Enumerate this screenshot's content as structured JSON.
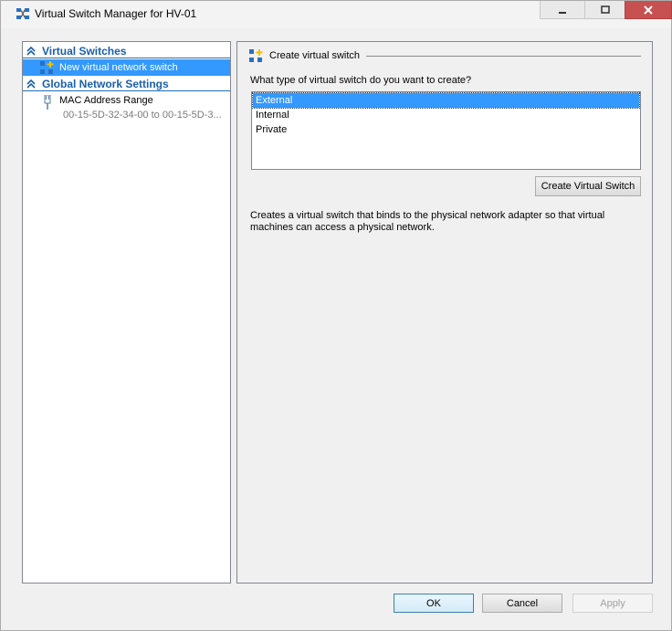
{
  "window": {
    "title": "Virtual Switch Manager for HV-01"
  },
  "titlebar_controls": {
    "minimize_icon": "minimize-icon",
    "maximize_icon": "maximize-icon",
    "close_icon": "close-icon"
  },
  "sidebar": {
    "sections": [
      {
        "label": "Virtual Switches",
        "items": [
          {
            "label": "New virtual network switch",
            "icon": "add-switch-icon",
            "selected": true
          }
        ]
      },
      {
        "label": "Global Network Settings",
        "items": [
          {
            "label": "MAC Address Range",
            "sublabel": "00-15-5D-32-34-00 to 00-15-5D-3...",
            "icon": "network-adapter-icon"
          }
        ]
      }
    ]
  },
  "main": {
    "group_title": "Create virtual switch",
    "question": "What type of virtual switch do you want to create?",
    "options": [
      "External",
      "Internal",
      "Private"
    ],
    "selected_option": "External",
    "create_button": "Create Virtual Switch",
    "description": "Creates a virtual switch that binds to the physical network adapter so that virtual machines can access a physical network."
  },
  "footer": {
    "ok": "OK",
    "cancel": "Cancel",
    "apply": "Apply"
  },
  "colors": {
    "selection": "#3399ff",
    "section_header": "#1a5fa8",
    "close_button": "#c75050"
  }
}
